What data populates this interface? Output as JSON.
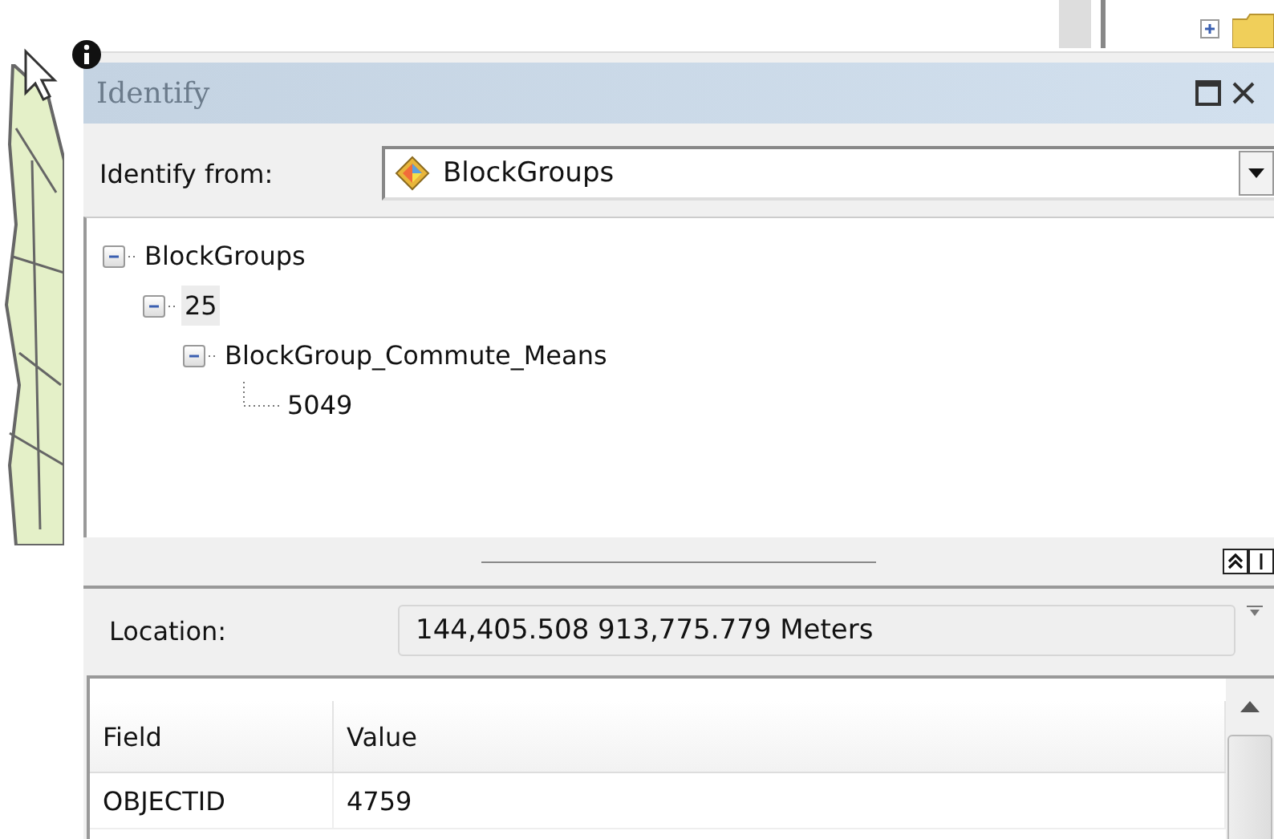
{
  "window": {
    "title": "Identify"
  },
  "identify_from": {
    "label": "Identify from:",
    "value": "BlockGroups"
  },
  "tree": [
    {
      "label": "BlockGroups",
      "expanded": true,
      "selected": false,
      "children": [
        {
          "label": "25",
          "expanded": true,
          "selected": true,
          "children": [
            {
              "label": "BlockGroup_Commute_Means",
              "expanded": true,
              "selected": false,
              "children": [
                {
                  "label": "5049",
                  "selected": false
                }
              ]
            }
          ]
        }
      ]
    }
  ],
  "location": {
    "label": "Location:",
    "value": "144,405.508  913,775.779 Meters"
  },
  "table": {
    "columns": [
      "Field",
      "Value"
    ],
    "rows": [
      [
        "OBJECTID",
        "4759"
      ]
    ]
  }
}
